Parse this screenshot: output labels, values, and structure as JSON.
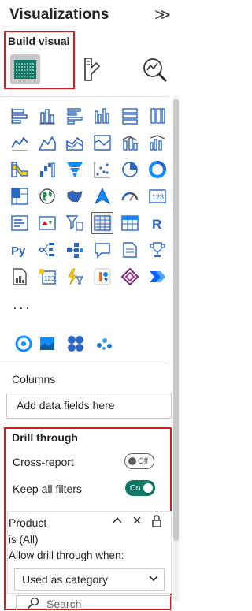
{
  "header": {
    "title": "Visualizations",
    "collapse_glyph": "≫"
  },
  "tabs": {
    "build_visual": "Build visual"
  },
  "visual_icons": [
    "stacked-bar-icon",
    "stacked-column-icon",
    "clustered-bar-icon",
    "clustered-column-icon",
    "100-stacked-bar-icon",
    "100-stacked-column-icon",
    "line-chart-icon",
    "area-chart-icon",
    "stacked-area-icon",
    "100-stacked-area-icon",
    "line-and-stacked-column-icon",
    "line-and-clustered-column-icon",
    "ribbon-chart-icon",
    "waterfall-icon",
    "funnel-icon",
    "scatter-icon",
    "pie-icon",
    "donut-icon",
    "treemap-icon",
    "map-icon",
    "filled-map-icon",
    "azure-map-icon",
    "gauge-icon",
    "card-icon",
    "multi-row-card-icon",
    "kpi-icon",
    "slicer-icon",
    "table-icon",
    "matrix-icon",
    "r-visual-icon",
    "python-visual-icon",
    "key-influencers-icon",
    "decomposition-tree-icon",
    "qa-icon",
    "smart-narrative-icon",
    "goals-icon",
    "paginated-report-icon",
    "new-card-icon",
    "button-slicer-icon",
    "azure-maps-2-icon",
    "power-apps-icon",
    "power-automate-icon"
  ],
  "more_glyph": "···",
  "custom_icons": [
    "custom-visual-1-icon",
    "custom-visual-2-icon",
    "custom-visual-3-icon",
    "custom-visual-4-icon"
  ],
  "well": {
    "label": "Columns",
    "placeholder": "Add data fields here"
  },
  "drill": {
    "title": "Drill through",
    "cross_report": {
      "label": "Cross-report",
      "state": "Off"
    },
    "keep_filters": {
      "label": "Keep all filters",
      "state": "On"
    }
  },
  "card": {
    "field": "Product",
    "filter": "is (All)",
    "allow_text": "Allow drill through when:",
    "dropdown_value": "Used as category"
  },
  "search": {
    "placeholder": "Search"
  },
  "colors": {
    "red_highlight": "#d71920",
    "toggle_on": "#117865",
    "teal": "#118dff"
  }
}
